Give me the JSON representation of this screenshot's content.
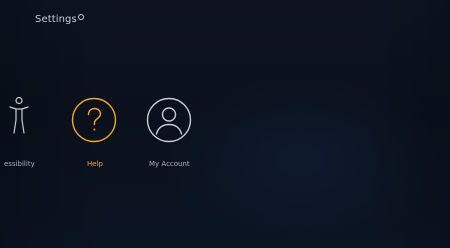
{
  "header": {
    "title": "Settings"
  },
  "menu": {
    "items": [
      {
        "label": "essibility",
        "icon": "accessibility-icon"
      },
      {
        "label": "Help",
        "icon": "help-icon"
      },
      {
        "label": "My Account",
        "icon": "account-icon"
      }
    ],
    "selected_index": 1
  },
  "colors": {
    "accent": "#f4a62a",
    "icon_inactive": "#c8ccd2",
    "text_inactive": "#aeb4bd",
    "background": "#0b121e"
  }
}
